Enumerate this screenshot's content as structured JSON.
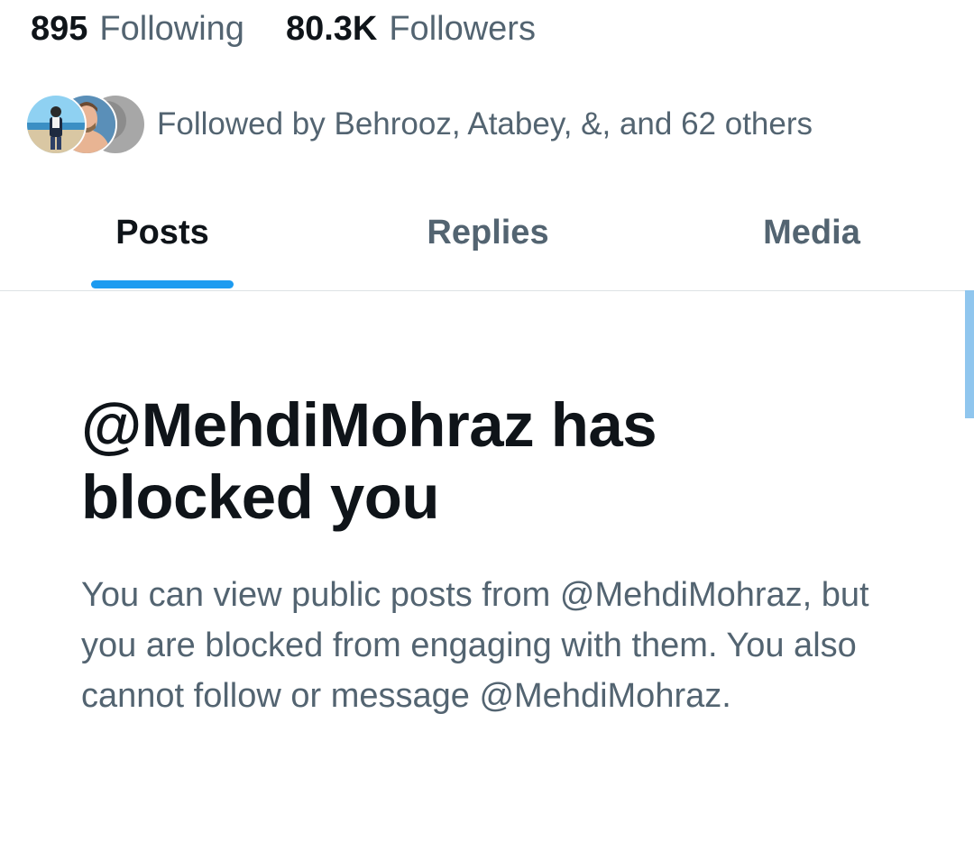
{
  "profile_stats": {
    "following_count": "895",
    "following_label": "Following",
    "followers_count": "80.3K",
    "followers_label": "Followers"
  },
  "followed_by": {
    "text": "Followed by Behrooz, Atabey, &, and 62 others",
    "avatars": [
      "avatar-behrooz",
      "avatar-atabey",
      "avatar-third"
    ]
  },
  "tabs": [
    {
      "label": "Posts",
      "active": true
    },
    {
      "label": "Replies",
      "active": false
    },
    {
      "label": "Media",
      "active": false
    }
  ],
  "blocked": {
    "title": "@MehdiMohraz has blocked you",
    "body": "You can view public posts from @MehdiMohraz, but you are blocked from engaging with them. You also cannot follow or message @MehdiMohraz."
  },
  "colors": {
    "accent": "#1d9bf0",
    "text_primary": "#0f1419",
    "text_secondary": "#536471",
    "divider": "#dde2e5"
  }
}
